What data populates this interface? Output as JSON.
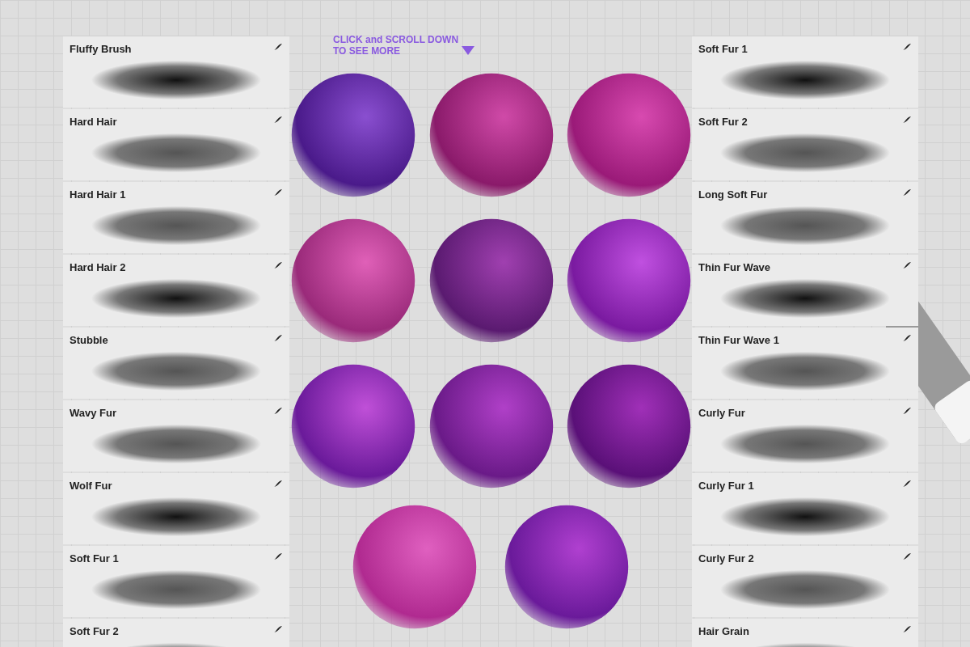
{
  "hint": {
    "text": "CLICK and SCROLL DOWN\nTO SEE MORE"
  },
  "left_brushes": [
    {
      "name": "Fluffy Brush"
    },
    {
      "name": "Hard Hair"
    },
    {
      "name": "Hard Hair 1"
    },
    {
      "name": "Hard Hair 2"
    },
    {
      "name": "Stubble"
    },
    {
      "name": "Wavy Fur"
    },
    {
      "name": "Wolf Fur"
    },
    {
      "name": "Soft Fur 1"
    },
    {
      "name": "Soft Fur 2"
    }
  ],
  "right_brushes": [
    {
      "name": "Soft Fur 1"
    },
    {
      "name": "Soft Fur 2"
    },
    {
      "name": "Long Soft Fur"
    },
    {
      "name": "Thin Fur Wave"
    },
    {
      "name": "Thin Fur Wave 1"
    },
    {
      "name": "Curly Fur"
    },
    {
      "name": "Curly Fur 1"
    },
    {
      "name": "Curly Fur 2"
    },
    {
      "name": "Hair Grain"
    }
  ]
}
